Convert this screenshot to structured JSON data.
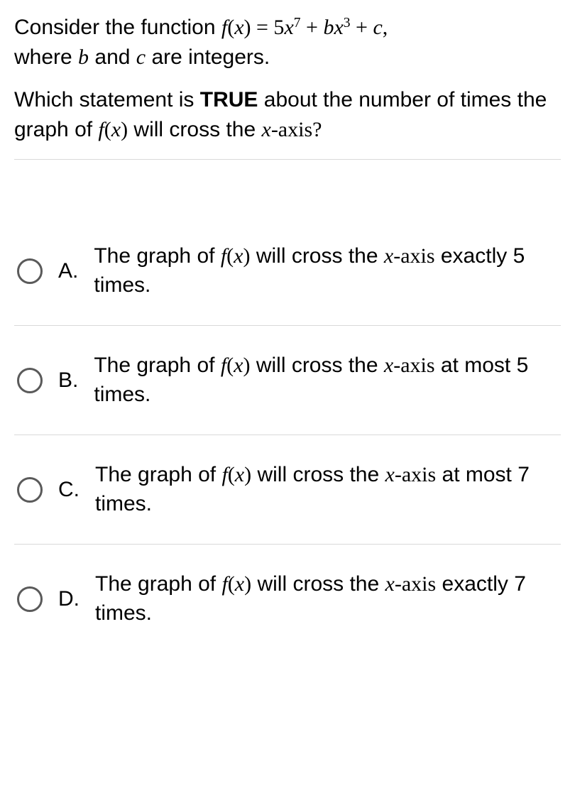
{
  "question": {
    "line1_pre": "Consider the function ",
    "line1_math_html": "<span class=\"mi\">f</span>(<span class=\"mi\">x</span>) = 5<span class=\"mi\">x</span><span class=\"sup\">7</span> + <span class=\"mi\">b</span><span class=\"mi\">x</span><span class=\"sup\">3</span> + <span class=\"mi\">c</span>,",
    "line2_pre": "where ",
    "line2_b_html": "<span class=\"mi\">b</span>",
    "line2_mid": " and ",
    "line2_c_html": "<span class=\"mi\">c</span>",
    "line2_post": " are integers.",
    "p2_pre": "Which statement is ",
    "p2_bold": "TRUE",
    "p2_mid": " about the number of times the graph of ",
    "p2_math_html": "<span class=\"mi\">f</span>(<span class=\"mi\">x</span>)",
    "p2_mid2": " will cross the ",
    "p2_xaxis_html": "<span class=\"mi\">x</span>-axis?"
  },
  "choices": [
    {
      "label": "A.",
      "pre": "The graph of ",
      "fx_html": "<span class=\"mi\">f</span>(<span class=\"mi\">x</span>)",
      "mid": " will cross the ",
      "xa_html": "<span class=\"mi\">x</span>-axis",
      "post": " exactly 5 times."
    },
    {
      "label": "B.",
      "pre": "The graph of ",
      "fx_html": "<span class=\"mi\">f</span>(<span class=\"mi\">x</span>)",
      "mid": " will cross the ",
      "xa_html": "<span class=\"mi\">x</span>-axis",
      "post": " at most 5 times."
    },
    {
      "label": "C.",
      "pre": "The graph of ",
      "fx_html": "<span class=\"mi\">f</span>(<span class=\"mi\">x</span>)",
      "mid": " will cross the ",
      "xa_html": "<span class=\"mi\">x</span>-axis",
      "post": " at most 7 times."
    },
    {
      "label": "D.",
      "pre": "The graph of ",
      "fx_html": "<span class=\"mi\">f</span>(<span class=\"mi\">x</span>)",
      "mid": " will cross the ",
      "xa_html": "<span class=\"mi\">x</span>-axis",
      "post": " exactly 7 times."
    }
  ]
}
